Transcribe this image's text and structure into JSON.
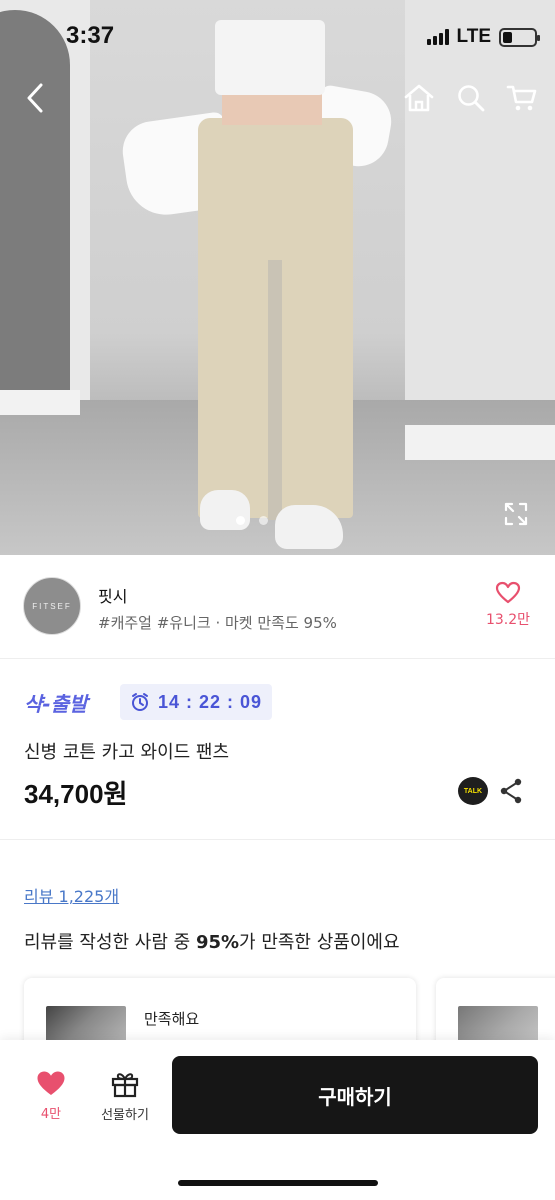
{
  "status_bar": {
    "time": "3:37",
    "network": "LTE",
    "battery_level": 0.25
  },
  "hero": {
    "icons": [
      "back-icon",
      "home-icon",
      "search-icon",
      "cart-icon",
      "expand-icon"
    ],
    "carousel": {
      "current": 1,
      "total": 2
    }
  },
  "seller": {
    "avatar_text": "FITSEF",
    "name": "핏시",
    "tags": "#캐주얼 #유니크 · 마켓 만족도 95%",
    "like_count": "13.2만"
  },
  "product": {
    "promo_label": "샥-출발",
    "timer": "14 : 22 : 09",
    "name": "신병 코튼 카고 와이드 팬츠",
    "price": "34,700원",
    "talk_label": "TALK"
  },
  "reviews": {
    "link": "리뷰 1,225개",
    "summary_prefix": "리뷰를 작성한 사람 중 ",
    "summary_percent": "95%",
    "summary_suffix": "가 만족한 상품이에요",
    "cards": [
      {
        "title": "만족해요"
      }
    ]
  },
  "bottom_bar": {
    "like_label": "4만",
    "gift_label": "선물하기",
    "buy_label": "구매하기"
  },
  "colors": {
    "accent": "#e8506e",
    "promo": "#5b63e0",
    "timer_bg": "#eef0fb",
    "buy_bg": "#161616",
    "link": "#4a78c8"
  }
}
